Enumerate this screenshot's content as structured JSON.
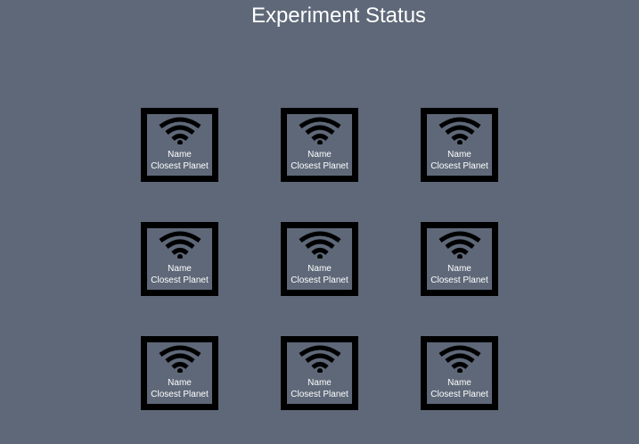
{
  "page": {
    "title": "Experiment Status"
  },
  "cards": [
    {
      "name": "Name",
      "planet": "Closest Planet",
      "icon": "wifi-icon"
    },
    {
      "name": "Name",
      "planet": "Closest Planet",
      "icon": "wifi-icon"
    },
    {
      "name": "Name",
      "planet": "Closest Planet",
      "icon": "wifi-icon"
    },
    {
      "name": "Name",
      "planet": "Closest Planet",
      "icon": "wifi-icon"
    },
    {
      "name": "Name",
      "planet": "Closest Planet",
      "icon": "wifi-icon"
    },
    {
      "name": "Name",
      "planet": "Closest Planet",
      "icon": "wifi-icon"
    },
    {
      "name": "Name",
      "planet": "Closest Planet",
      "icon": "wifi-icon"
    },
    {
      "name": "Name",
      "planet": "Closest Planet",
      "icon": "wifi-icon"
    },
    {
      "name": "Name",
      "planet": "Closest Planet",
      "icon": "wifi-icon"
    }
  ],
  "colors": {
    "background": "#5e6878",
    "card_frame": "#000000",
    "text": "#ffffff"
  }
}
